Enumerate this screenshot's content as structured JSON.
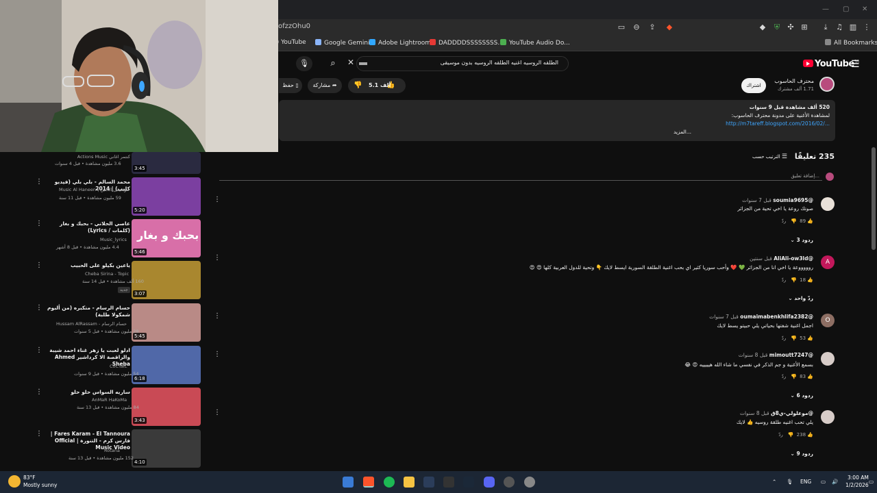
{
  "browser": {
    "url": "ofzzOhu0",
    "bookmarks": [
      {
        "label": "7) YouTube",
        "color": "#ff0000"
      },
      {
        "label": "Google Gemini",
        "color": "#8ab4f8"
      },
      {
        "label": "Adobe Lightroom",
        "color": "#31a8ff"
      },
      {
        "label": "DADDDDSSSSSSSS...",
        "color": "#e53935"
      },
      {
        "label": "YouTube Audio Do...",
        "color": "#4caf50"
      }
    ],
    "all_bookmarks_label": "All Bookmarks"
  },
  "youtube": {
    "logo_text": "YouTube",
    "region": "SA",
    "search_query": "الطلقه الروسيه اغنيه الطلقه الروسيه بدون موسيقى",
    "channel": {
      "name": "محترف الحاسوب",
      "subscribers": "1.71 ألف مشترك",
      "subscribe_label": "اشتراك"
    },
    "actions": {
      "likes": "5.1 ألف",
      "share_label": "مشاركة",
      "save_label": "حفظ"
    },
    "description": {
      "stats": "520 ألف مشاهدة  قبل 9 سنوات",
      "line2": "لمشاهدة الأغنية على مدونة محترف الحاسوب:",
      "link": "http://m7tareff.blogspot.com/2016/02/...",
      "more_label": "...المزيد"
    },
    "comments": {
      "count_label": "235 تعليقًا",
      "sort_label": "الترتيب حسب",
      "add_placeholder": "إضافة تعليق...",
      "items": [
        {
          "author": "@soumia9695",
          "time": "قبل 7 سنوات",
          "text": "صوتك روعة يا اخي تحية من الجزائر",
          "likes": "89",
          "replies": "3 ردود",
          "avatar_color": "#e8e0d8",
          "avatar_letter": ""
        },
        {
          "author": "@AliAli-ow3ld",
          "time": "قبل سنتين",
          "text": "روووووعة يا اخي انا من الجزائر 💚 ❤️ وأحب سوريا كثير اي بحب اغنية الطلقة السورية ايسط لايك 👇 وتحية للدول العربية كلها 😍 😍",
          "likes": "18",
          "replies": "ردّ واحد",
          "avatar_color": "#c2185b",
          "avatar_letter": "A"
        },
        {
          "author": "@oumaimabenkhlifa2382",
          "time": "قبل 7 سنوات",
          "text": "اجمل اغنية شفتها بحياتي يلي حبيتو يسط لايك",
          "likes": "53",
          "replies": "",
          "avatar_color": "#8d6e63",
          "avatar_letter": "O"
        },
        {
          "author": "@mimoutt7247",
          "time": "قبل 8 سنوات",
          "text": "بسمع الأغنية و جم الذكر في نفسي ما شاء الله هيييييه 😍 😂",
          "likes": "83",
          "replies": "6 ردود",
          "avatar_color": "#d7ccc8",
          "avatar_letter": ""
        },
        {
          "author": "@موعلولي-ي8ق",
          "time": "قبل 8 سنوات",
          "text": "يلي تحب اغنيه طلقة روسيه 👍 لايك",
          "likes": "238",
          "replies": "9 ردود",
          "avatar_color": "#d7ccc8",
          "avatar_letter": ""
        }
      ],
      "reply_label": "ردّ"
    },
    "sidebar_videos": [
      {
        "title": "كنتمر اغاني",
        "channel": "Actions Music",
        "meta": "3.6 مليون مشاهدة • قبل 4 سنوات",
        "duration": "3:45",
        "thumb": "#2a2a40"
      },
      {
        "title": "محمد السالم - بلي بلي (فيديو كليب) | 2014",
        "channel": "موسيقى الحنين | Music Al Haneen",
        "meta": "59 مليون مشاهدة • قبل 11 سنة",
        "duration": "5:20",
        "thumb": "#7b3fa0"
      },
      {
        "title": "عاصي الحلاني - بحبك و بغار (كلمات / Lyrics)",
        "channel": "Music_lyrics",
        "meta": "4.4 مليون مشاهدة • قبل 8 أشهر",
        "duration": "5:46",
        "thumb": "#d86fa8",
        "thumb_text": "بحبك و بغار"
      },
      {
        "title": "ياعين بكيلو على الحبيب",
        "channel": "Cheba Sirina - Topic",
        "meta": "160 ألف مشاهدة • قبل 14 سنة",
        "duration": "3:07",
        "thumb": "#a9872f",
        "badge": "جديد"
      },
      {
        "title": "حسام الرسام - متكبره (من ألبوم شمكولا طلبة)",
        "channel": "حسام الرسام - Hussam AlRassam",
        "meta": "28 مليون مشاهدة • قبل 5 سنوات",
        "duration": "5:45",
        "thumb": "#b98a86"
      },
      {
        "title": "ادلو لعبت يا زهر غناء احمد شيبة والراقصة الا كرداشير Ahmed Sheba",
        "channel": "CoCTaiL",
        "meta": "54 مليون مشاهدة • قبل 9 سنوات",
        "duration": "6:18",
        "thumb": "#5068a8"
      },
      {
        "title": "ساريه السواس حلو حلو",
        "channel": "AnMaR HaKoMa",
        "meta": "84 مليون مشاهدة • قبل 13 سنة",
        "duration": "3:43",
        "thumb": "#c94a55"
      },
      {
        "title": "Fares Karam - El Tannoura | فارس كرم - التنورة | Official Music Video",
        "channel": "Rotana",
        "meta": "152 مليون مشاهدة • قبل 13 سنة",
        "duration": "4:10",
        "thumb": "#3a3a3a"
      }
    ]
  },
  "taskbar": {
    "weather_temp": "83°F",
    "weather_desc": "Mostly sunny",
    "lang": "ENG",
    "time": "3:00 AM",
    "date": "1/2/2026"
  }
}
